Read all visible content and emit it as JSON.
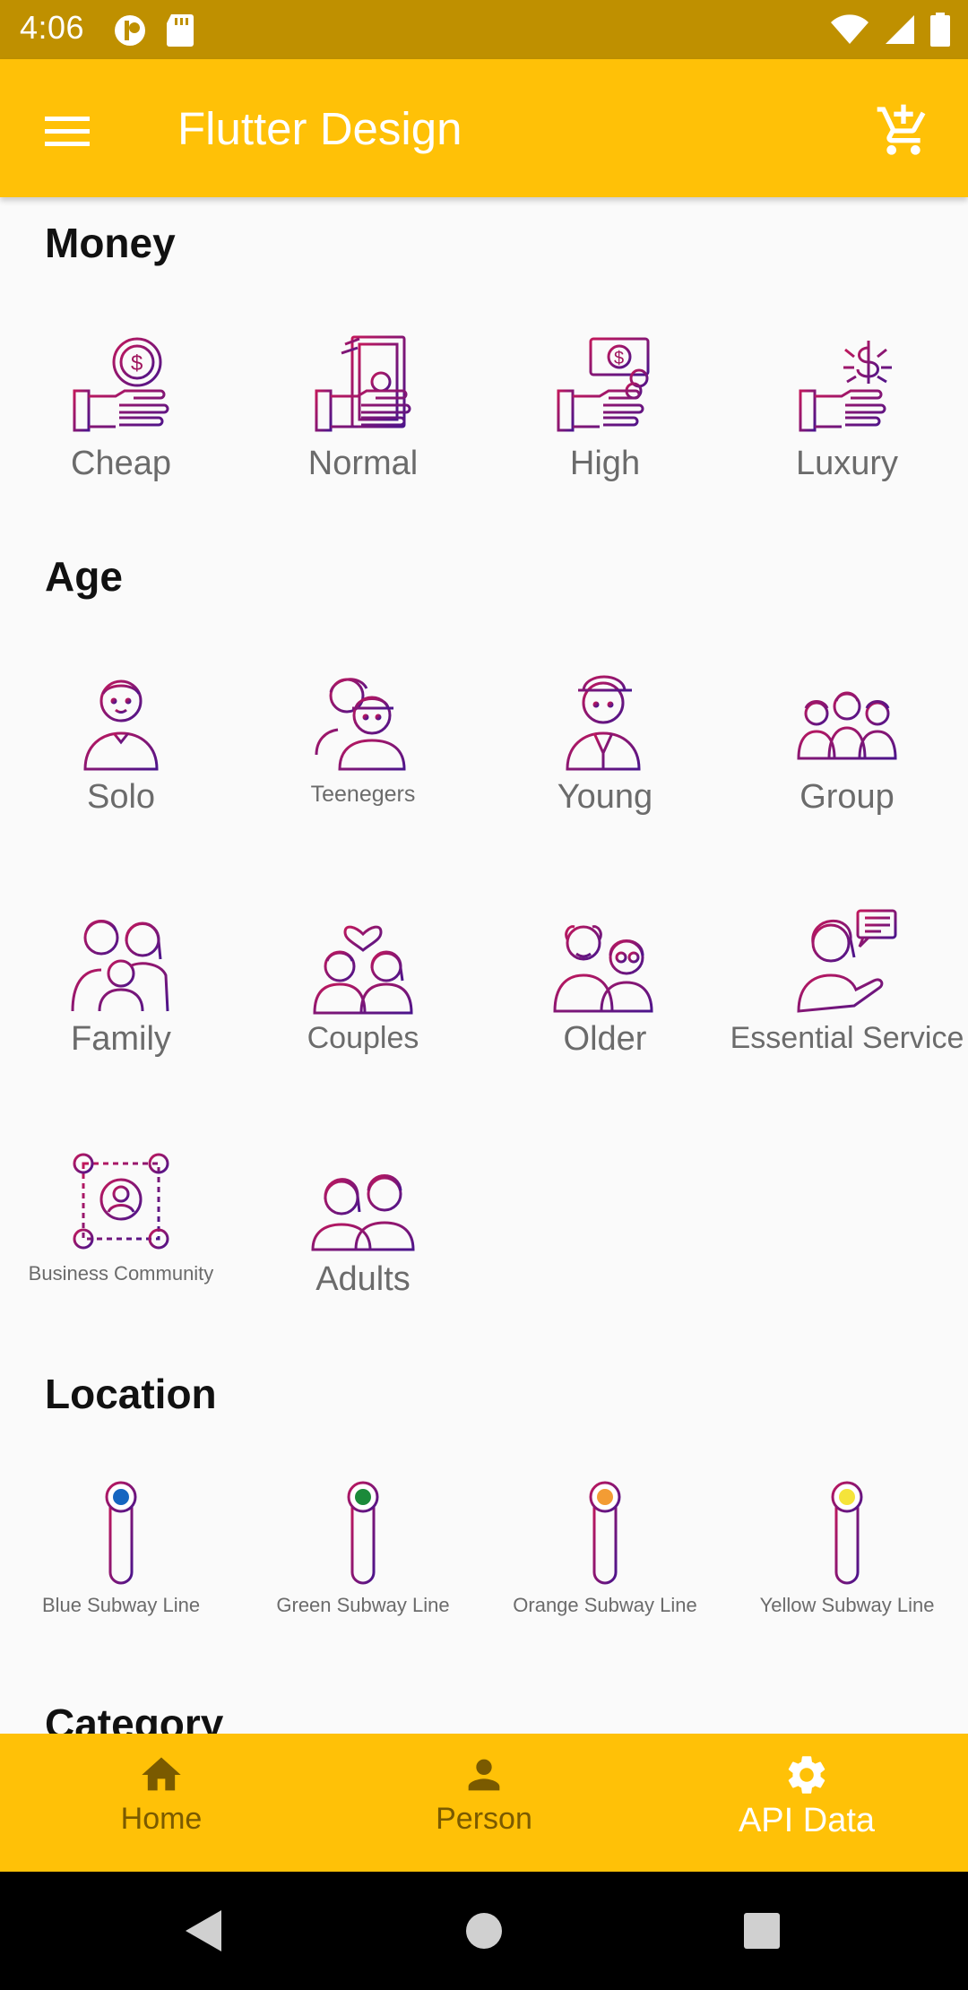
{
  "status_bar": {
    "time": "4:06"
  },
  "app_bar": {
    "title": "Flutter Design"
  },
  "sections": {
    "money": {
      "title": "Money",
      "items": [
        {
          "label": "Cheap",
          "icon": "cheap-money-icon"
        },
        {
          "label": "Normal",
          "icon": "normal-money-icon"
        },
        {
          "label": "High",
          "icon": "high-money-icon"
        },
        {
          "label": "Luxury",
          "icon": "luxury-money-icon"
        }
      ]
    },
    "age": {
      "title": "Age",
      "items": [
        {
          "label": "Solo",
          "icon": "solo-person-icon"
        },
        {
          "label": "Teenegers",
          "icon": "teenagers-icon"
        },
        {
          "label": "Young",
          "icon": "young-person-icon"
        },
        {
          "label": "Group",
          "icon": "group-icon"
        },
        {
          "label": "Family",
          "icon": "family-icon"
        },
        {
          "label": "Couples",
          "icon": "couples-icon"
        },
        {
          "label": "Older",
          "icon": "older-couple-icon"
        },
        {
          "label": "Essential Service",
          "icon": "essential-service-icon"
        },
        {
          "label": "Business Community",
          "icon": "business-community-icon"
        },
        {
          "label": "Adults",
          "icon": "adults-icon"
        }
      ]
    },
    "location": {
      "title": "Location",
      "items": [
        {
          "label": "Blue Subway Line",
          "color": "#1565c0"
        },
        {
          "label": "Green Subway Line",
          "color": "#1b8a3a"
        },
        {
          "label": "Orange Subway Line",
          "color": "#f39c34"
        },
        {
          "label": "Yellow Subway Line",
          "color": "#f5e43a"
        }
      ]
    },
    "category": {
      "title": "Category"
    }
  },
  "bottom_nav": {
    "items": [
      {
        "label": "Home",
        "icon": "home-icon"
      },
      {
        "label": "Person",
        "icon": "person-icon"
      },
      {
        "label": "API Data",
        "icon": "gear-icon"
      }
    ],
    "active_index": 2
  },
  "colors": {
    "status_bar": "#bf9000",
    "app_bar": "#ffc107",
    "icon_gradient_start": "#c2185b",
    "icon_gradient_end": "#4a148c"
  }
}
